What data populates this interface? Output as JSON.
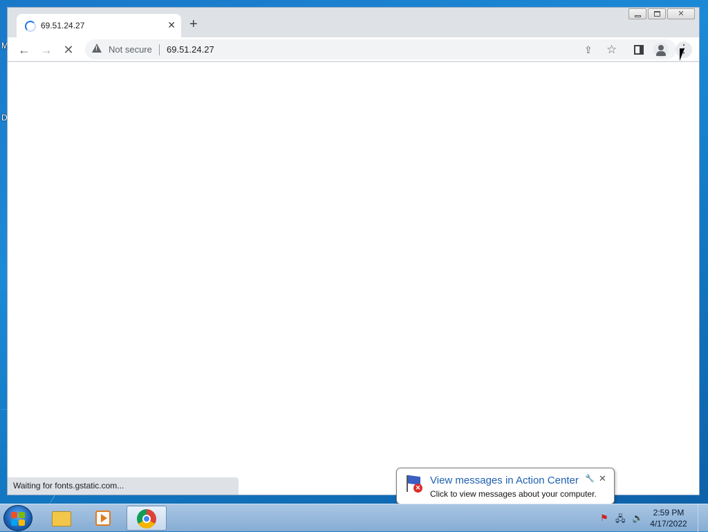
{
  "desktop": {
    "frag1": "M",
    "frag2": "D"
  },
  "browser": {
    "tab": {
      "title": "69.51.24.27",
      "close_icon": "close-icon"
    },
    "newtab_glyph": "+",
    "omnibox": {
      "security_label": "Not secure",
      "url": "69.51.24.27"
    },
    "status_text": "Waiting for fonts.gstatic.com..."
  },
  "notification": {
    "title": "View messages in Action Center",
    "text": "Click to view messages about your computer."
  },
  "taskbar": {
    "time": "2:59 PM",
    "date": "4/17/2022"
  }
}
